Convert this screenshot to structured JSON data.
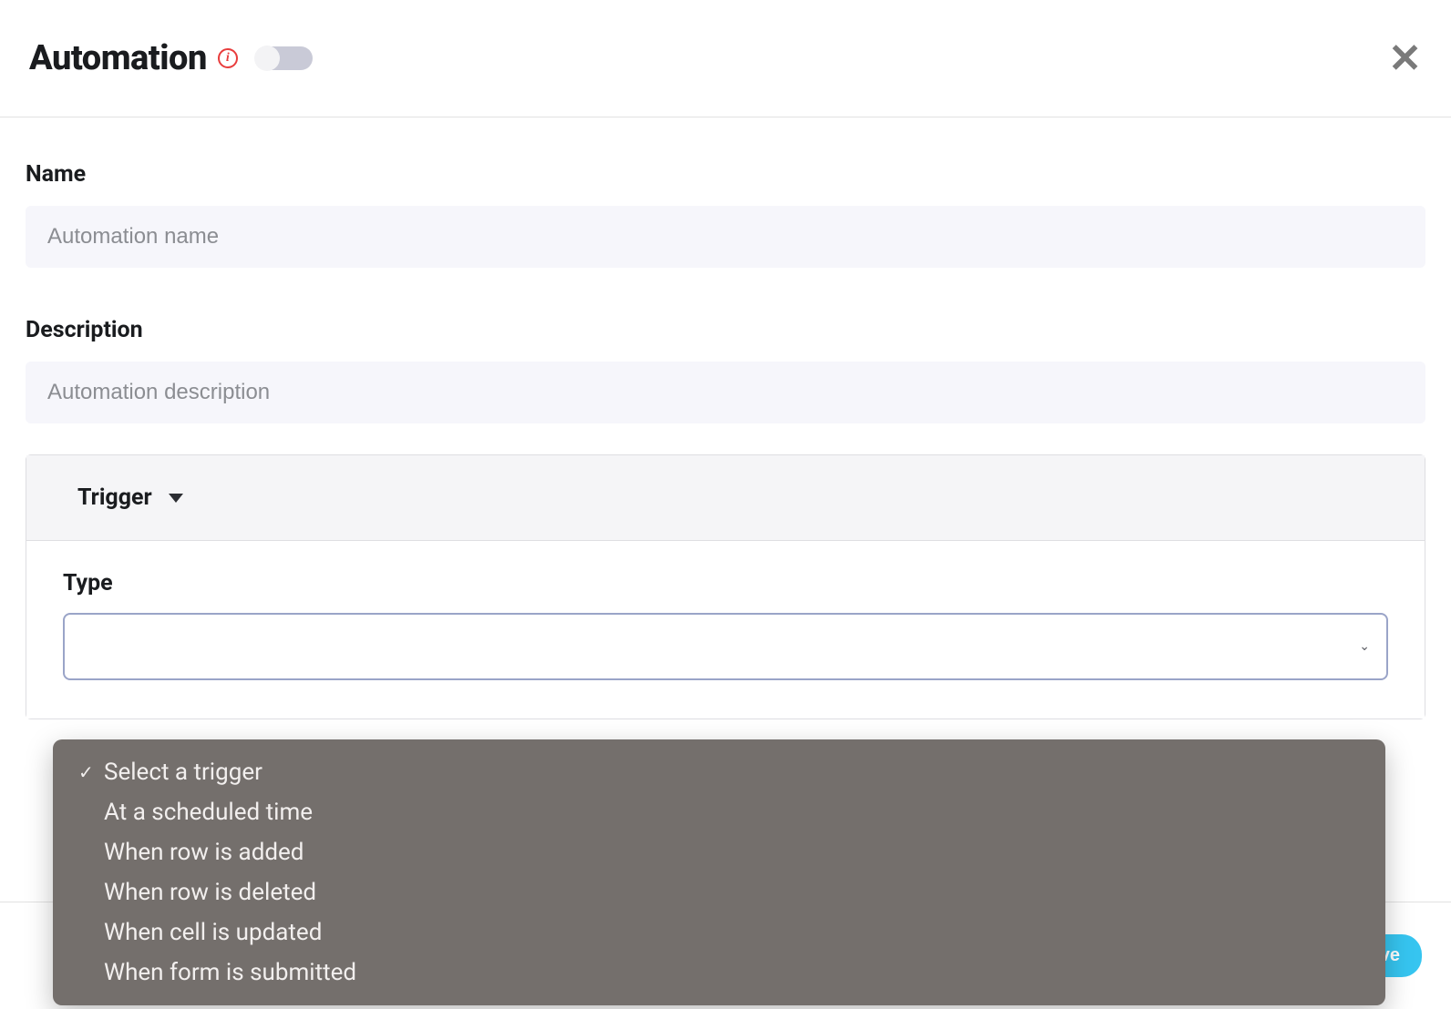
{
  "header": {
    "title": "Automation"
  },
  "fields": {
    "name_label": "Name",
    "name_placeholder": "Automation name",
    "name_value": "",
    "description_label": "Description",
    "description_placeholder": "Automation description",
    "description_value": ""
  },
  "trigger": {
    "section_title": "Trigger",
    "type_label": "Type",
    "options": [
      {
        "label": "Select a trigger",
        "selected": true
      },
      {
        "label": "At a scheduled time",
        "selected": false
      },
      {
        "label": "When row is added",
        "selected": false
      },
      {
        "label": "When row is deleted",
        "selected": false
      },
      {
        "label": "When cell is updated",
        "selected": false
      },
      {
        "label": "When form is submitted",
        "selected": false
      }
    ]
  },
  "footer": {
    "save_label": "Save"
  }
}
